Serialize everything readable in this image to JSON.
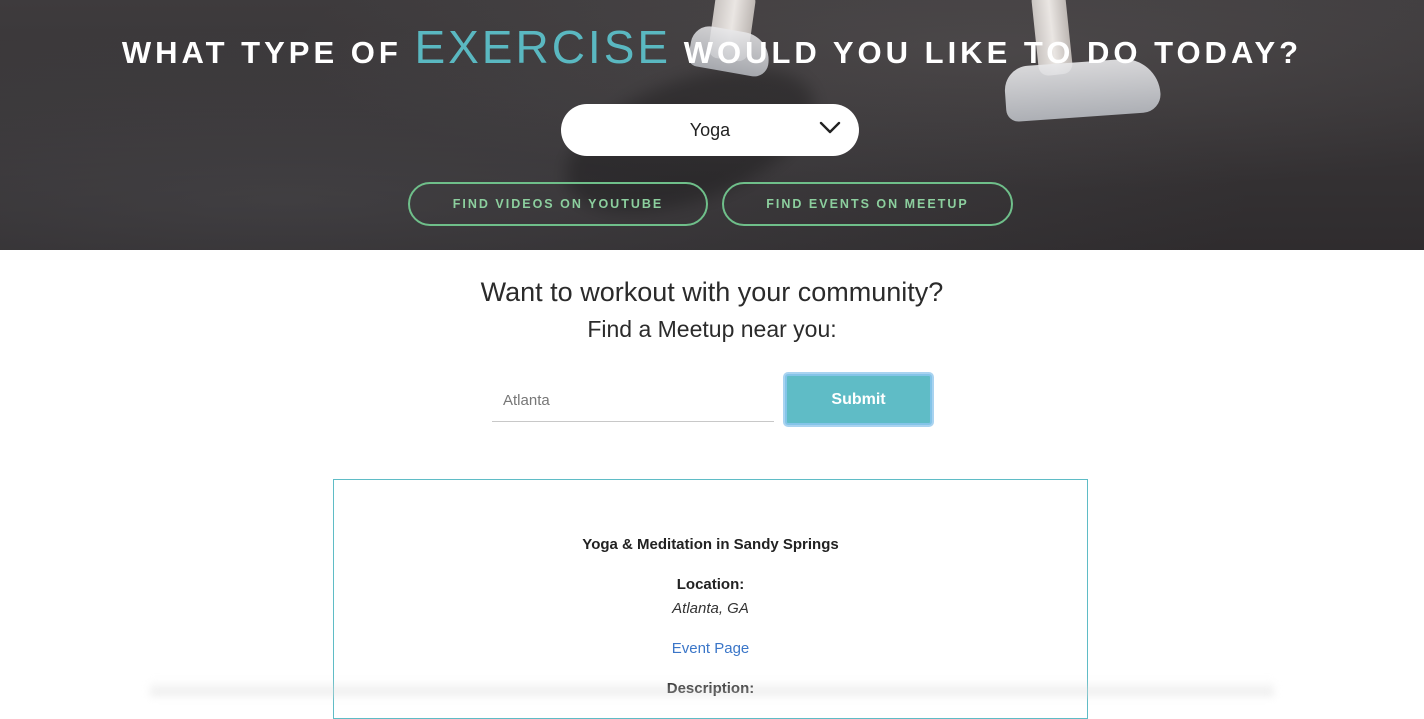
{
  "hero": {
    "title_before": "WHAT TYPE OF",
    "title_accent": "EXERCISE",
    "title_after": "WOULD YOU LIKE TO DO TODAY?",
    "select_value": "Yoga",
    "select_icon": "chevron-down-icon",
    "youtube_button": "FIND VIDEOS ON YOUTUBE",
    "meetup_button": "FIND EVENTS ON MEETUP",
    "accent_color": "#5ab8c1",
    "button_color": "#6fbf8a"
  },
  "community": {
    "headline": "Want to workout with your community?",
    "subline": "Find a Meetup near you:",
    "input_placeholder": "Atlanta",
    "submit_label": "Submit",
    "submit_color": "#5fbcc6"
  },
  "result": {
    "title": "Yoga & Meditation in Sandy Springs",
    "location_label": "Location:",
    "location_value": "Atlanta, GA",
    "event_link": "Event Page",
    "description_label": "Description:"
  }
}
